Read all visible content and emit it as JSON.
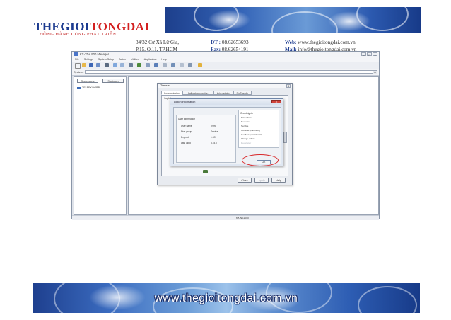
{
  "header": {
    "logo_part1": "THEGIOI",
    "logo_part2": "TONGDAI",
    "slogan": "ĐỒNG HÀNH CÙNG PHÁT TRIỂN",
    "address_line1": "34/32 Cư Xá Lữ Gia,",
    "address_line2": "P.15, Q.11, TP.HCM",
    "phone_label": "ĐT :",
    "phone_value": "08.62653693",
    "fax_label": "Fax:",
    "fax_value": "08.62654191",
    "web_label": "Web:",
    "web_value": "www.thegioitongdai.com.vn",
    "mail_label": "Mail:",
    "mail_value": "info@thegioitongdai.com.vn"
  },
  "app": {
    "title": "KX-TDA 900 Manager",
    "menu_items": [
      "File",
      "Settings",
      "System Setup",
      "Action",
      "Utilities",
      "Application",
      "Help"
    ],
    "system_label": "System:",
    "left_tabs": [
      "Systemnets",
      "Stationen"
    ],
    "tree_item": "TELPEX/NGBB",
    "status_text": "KX-NS1000"
  },
  "transfer_dialog": {
    "title": "Transfer",
    "close": "X",
    "tabs": [
      "Communication",
      "Callback connection",
      "Lebensdaten",
      "Siv Transfer"
    ],
    "section_label": "Kapitel",
    "buttons": {
      "close": "Close",
      "apply": "Apply",
      "help": "Help"
    }
  },
  "logon_dialog": {
    "title": "Logon information",
    "close": "X",
    "info_header": "User information",
    "rows": [
      {
        "key": "User name",
        "value": "X999"
      },
      {
        "key": "First group",
        "value": "Service"
      },
      {
        "key": "Expired",
        "value": "1.120"
      },
      {
        "key": "Last used",
        "value": "8.15.0"
      }
    ],
    "list_header": "Grund rights",
    "list_items": [
      "Site admin",
      "Reviewer",
      "Service",
      "Confidel (comment)",
      "Confidel (confidential)",
      "Charge admin",
      "Developer"
    ],
    "list_dim_index": 6,
    "ok_label": "OK"
  },
  "footer": {
    "url": "www.thegioitongdai.com.vn"
  },
  "colors": {
    "brand_blue": "#1b3a8f",
    "brand_red": "#d32020",
    "highlight_red": "#d8282a"
  }
}
